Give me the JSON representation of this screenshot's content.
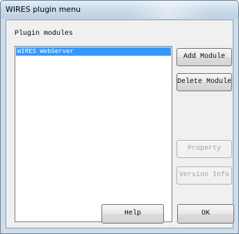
{
  "window": {
    "title": "WIRES plugin menu"
  },
  "plugin_section": {
    "label": "Plugin modules",
    "modules": [
      {
        "name": "WIRES WebServer",
        "selected": true
      }
    ]
  },
  "buttons": {
    "add_module": "Add Module",
    "delete_module": "Delete Module",
    "property": "Property",
    "version_info": "Version Info",
    "help": "Help",
    "ok": "OK"
  },
  "colors": {
    "selection": "#3399ff",
    "dialog_face": "#f0f0f0",
    "frame": "#cfdde9",
    "disabled_text": "#a0a0a0"
  }
}
